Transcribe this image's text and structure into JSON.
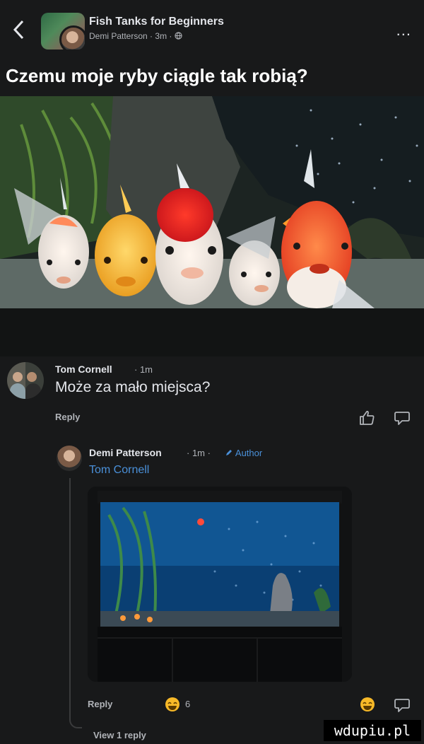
{
  "header": {
    "back_icon": "chevron-left-icon",
    "group_name": "Fish Tanks for Beginners",
    "author": "Demi Patterson",
    "time": "3m",
    "privacy_icon": "globe-icon",
    "more_icon": "more-icon",
    "more_glyph": "..."
  },
  "post": {
    "text": "Czemu moje ryby ciągle tak robią?"
  },
  "comment": {
    "author": "Tom Cornell",
    "time": "1m",
    "text": "Może za mało miejsca?",
    "reply_label": "Reply",
    "like_icon": "thumbs-up-icon",
    "reply_icon": "reply-bubble-icon"
  },
  "reply": {
    "author": "Demi Patterson",
    "time": "1m",
    "badge": "Author",
    "mention": "Tom Cornell",
    "reply_label": "Reply",
    "reaction_icon": "haha-emoji-icon",
    "reaction_count": "6"
  },
  "thread": {
    "view_replies": "View 1 reply"
  },
  "watermark": "wdupiu.pl"
}
